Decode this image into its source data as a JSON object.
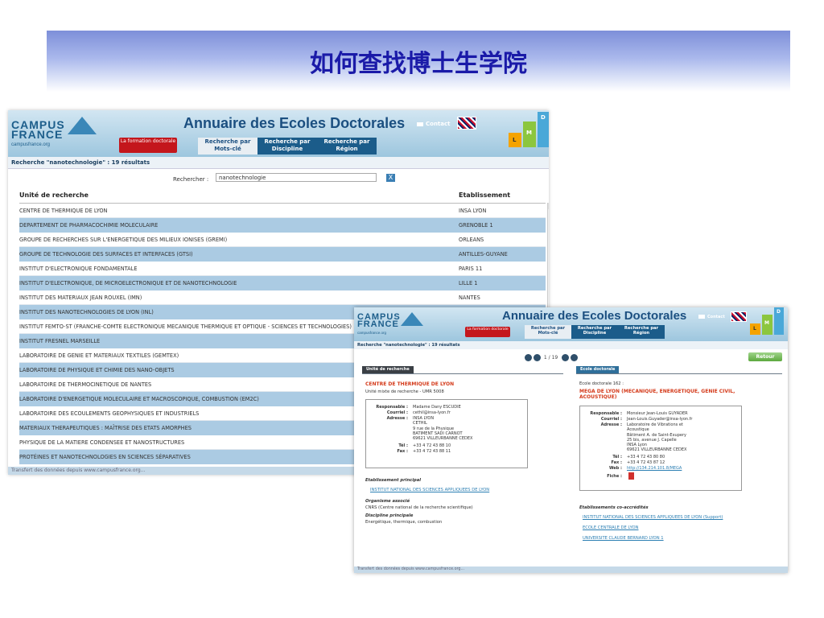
{
  "slide": {
    "title": "如何查找博士生学院"
  },
  "common": {
    "brand_line1": "CAMPUS",
    "brand_line2": "FRANCE",
    "brand_url": "campusfrance.org",
    "app_title": "Annuaire des Ecoles Doctorales",
    "contact": "Contact",
    "nav_formation": "La formation doctorale",
    "tab_mots": "Recherche par Mots-clé",
    "tab_discipline": "Recherche par Discipline",
    "tab_region": "Recherche par Région",
    "lmd_l": "L",
    "lmd_m": "M",
    "lmd_d": "D",
    "results_summary": "Recherche \"nanotechnologie\" : 19 résultats",
    "footer": "Transfert des données depuis www.campusfrance.org..."
  },
  "shot1": {
    "search_label": "Rechercher :",
    "search_value": "nanotechnologie",
    "clear": "X",
    "col_unit": "Unité de recherche",
    "col_etab": "Etablissement",
    "rows": [
      {
        "unit": "CENTRE DE THERMIQUE DE LYON",
        "etab": "INSA LYON"
      },
      {
        "unit": "DEPARTEMENT DE PHARMACOCHIMIE MOLECULAIRE",
        "etab": "GRENOBLE 1"
      },
      {
        "unit": "GROUPE DE RECHERCHES SUR L'ENERGETIQUE DES MILIEUX IONISES (GREMI)",
        "etab": "ORLEANS"
      },
      {
        "unit": "GROUPE DE TECHNOLOGIE DES SURFACES ET INTERFACES (GTSI)",
        "etab": "ANTILLES-GUYANE"
      },
      {
        "unit": "INSTITUT D'ELECTRONIQUE FONDAMENTALE",
        "etab": "PARIS 11"
      },
      {
        "unit": "INSTITUT D'ELECTRONIQUE, DE MICROELECTRONIQUE ET DE NANOTECHNOLOGIE",
        "etab": "LILLE 1"
      },
      {
        "unit": "INSTITUT DES MATERIAUX JEAN ROUXEL (IMN)",
        "etab": "NANTES"
      },
      {
        "unit": "INSTITUT DES NANOTECHNOLOGIES DE LYON (INL)",
        "etab": ""
      },
      {
        "unit": "INSTITUT FEMTO-ST (FRANCHE-COMTE ELECTRONIQUE MECANIQUE THERMIQUE ET OPTIQUE - SCIENCES ET TECHNOLOGIES)",
        "etab": ""
      },
      {
        "unit": "INSTITUT FRESNEL MARSEILLE",
        "etab": ""
      },
      {
        "unit": "LABORATOIRE DE GENIE ET MATERIAUX TEXTILES (GEMTEX)",
        "etab": ""
      },
      {
        "unit": "LABORATOIRE DE PHYSIQUE ET CHIMIE DES NANO-OBJETS",
        "etab": ""
      },
      {
        "unit": "LABORATOIRE DE THERMOCINETIQUE DE NANTES",
        "etab": ""
      },
      {
        "unit": "LABORATOIRE D'ENERGETIQUE MOLECULAIRE ET MACROSCOPIQUE, COMBUSTION (EM2C)",
        "etab": ""
      },
      {
        "unit": "LABORATOIRE DES ECOULEMENTS GEOPHYSIQUES ET INDUSTRIELS",
        "etab": ""
      },
      {
        "unit": "MATERIAUX THERAPEUTIQUES : MAÎTRISE DES ETATS AMORPHES",
        "etab": ""
      },
      {
        "unit": "PHYSIQUE DE LA MATIERE CONDENSEE ET NANOSTRUCTURES",
        "etab": ""
      },
      {
        "unit": "PROTÉINES ET NANOTECHNOLOGIES EN SCIENCES SÉPARATIVES",
        "etab": ""
      }
    ]
  },
  "shot2": {
    "pager_text": "1 / 19",
    "retour": "Retour",
    "unit_tab": "Unité de recherche",
    "ecole_tab": "Ecole doctorale",
    "unit_name": "CENTRE DE THERMIQUE DE LYON",
    "unit_type": "Unité mixte de recherche - UMR 5008",
    "left_box": {
      "l_resp": "Responsable :",
      "v_resp": "Madame Dany ESCUDIE",
      "l_mail": "Courriel :",
      "v_mail": "cethil@insa-lyon.fr",
      "l_addr": "Adresse :",
      "v_addr": "INSA LYON\nCETHIL\n9 rue de la Physique\nBATIMENT SADI CARNOT\n69621 VILLEURBANNE CEDEX",
      "l_tel": "Tél :",
      "v_tel": "+33 4 72 43 88 10",
      "l_fax": "Fax :",
      "v_fax": "+33 4 72 43 88 11"
    },
    "etab_principal_title": "Etablissement principal",
    "etab_principal": "INSTITUT NATIONAL DES SCIENCES APPLIQUEES DE LYON",
    "organisme_title": "Organisme associé",
    "organisme": "CNRS (Centre national de la recherche scientifique)",
    "discipline_title": "Discipline principale",
    "discipline": "Energétique, thermique, combustion",
    "ecole_number": "Ecole doctorale 162 :",
    "ecole_name_1": "MEGA DE LYON (MECANIQUE, ENERGETIQUE, GENIE CIVIL,",
    "ecole_name_2": "ACOUSTIQUE)",
    "right_box": {
      "l_resp": "Responsable :",
      "v_resp": "Monsieur Jean-Louis GUYADER",
      "l_mail": "Courriel :",
      "v_mail": "Jean-Louis.Guyader@insa-lyon.fr",
      "l_addr": "Adresse :",
      "v_addr": "Laboratoire de Vibrations et\nAcoustique\nBâtiment A. de Saint-Exupery\n25 bis, avenue J. Capelle\nINSA Lyon\n69621 VILLEURBANNE CEDEX",
      "l_tel": "Tél :",
      "v_tel": "+33 4 72 43 80 80",
      "l_fax": "Fax :",
      "v_fax": "+33 4 72 43 87 12",
      "l_web": "Web :",
      "v_web": "http://134.214.101.8/MEGA",
      "l_fiche": "Fiche :"
    },
    "accredites_title": "Etablissements co-accrédités",
    "accredites": [
      "INSTITUT NATIONAL DES SCIENCES APPLIQUEES DE LYON (Support)",
      "ECOLE CENTRALE DE LYON",
      "UNIVERSITE CLAUDE BERNARD LYON 1"
    ],
    "footer": "Transfert des données depuis www.campusfrance.org..."
  },
  "colors": {
    "title": "#1a1aa8",
    "row_alt": "#abcbe3",
    "header_blue": "#1b5c8a",
    "accent_red": "#c4161c",
    "link": "#2c7fb3"
  }
}
